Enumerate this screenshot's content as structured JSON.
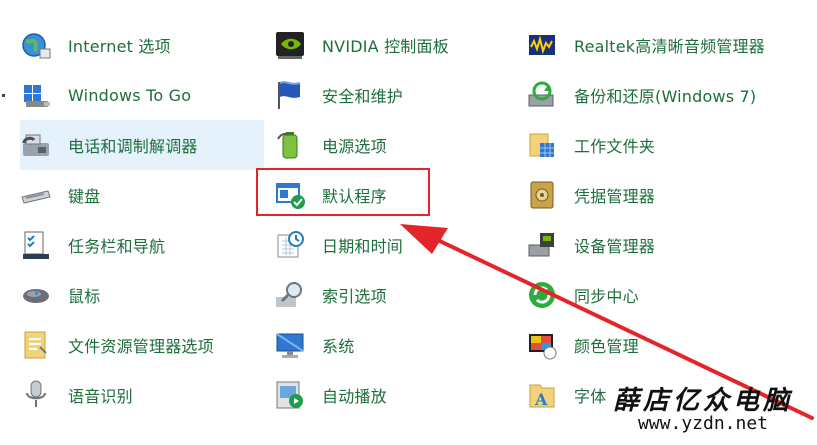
{
  "items": [
    {
      "key": "internet",
      "label": "Internet 选项",
      "icon": "globe-icon",
      "col": 0,
      "row": 0
    },
    {
      "key": "windows-to-go",
      "label": "Windows To Go",
      "icon": "usb-drive-icon",
      "col": 0,
      "row": 1
    },
    {
      "key": "phone-modem",
      "label": "电话和调制解调器",
      "icon": "phone-fax-icon",
      "col": 0,
      "row": 2,
      "hover": true
    },
    {
      "key": "keyboard",
      "label": "键盘",
      "icon": "keyboard-icon",
      "col": 0,
      "row": 3
    },
    {
      "key": "taskbar",
      "label": "任务栏和导航",
      "icon": "taskbar-checklist-icon",
      "col": 0,
      "row": 4
    },
    {
      "key": "mouse",
      "label": "鼠标",
      "icon": "mouse-icon",
      "col": 0,
      "row": 5
    },
    {
      "key": "file-explorer-options",
      "label": "文件资源管理器选项",
      "icon": "folder-options-icon",
      "col": 0,
      "row": 6
    },
    {
      "key": "speech",
      "label": "语音识别",
      "icon": "microphone-icon",
      "col": 0,
      "row": 7
    },
    {
      "key": "nvidia",
      "label": "NVIDIA 控制面板",
      "icon": "nvidia-icon",
      "col": 1,
      "row": 0
    },
    {
      "key": "security-maintenance",
      "label": "安全和维护",
      "icon": "flag-icon",
      "col": 1,
      "row": 1
    },
    {
      "key": "power",
      "label": "电源选项",
      "icon": "battery-icon",
      "col": 1,
      "row": 2
    },
    {
      "key": "default-programs",
      "label": "默认程序",
      "icon": "default-programs-icon",
      "col": 1,
      "row": 3
    },
    {
      "key": "date-time",
      "label": "日期和时间",
      "icon": "calendar-clock-icon",
      "col": 1,
      "row": 4
    },
    {
      "key": "indexing",
      "label": "索引选项",
      "icon": "magnifier-index-icon",
      "col": 1,
      "row": 5
    },
    {
      "key": "system",
      "label": "系统",
      "icon": "monitor-icon",
      "col": 1,
      "row": 6
    },
    {
      "key": "autoplay",
      "label": "自动播放",
      "icon": "autoplay-icon",
      "col": 1,
      "row": 7
    },
    {
      "key": "realtek",
      "label": "Realtek高清晰音频管理器",
      "icon": "audio-meter-icon",
      "col": 2,
      "row": 0
    },
    {
      "key": "backup-restore",
      "label": "备份和还原(Windows 7)",
      "icon": "backup-restore-icon",
      "col": 2,
      "row": 1
    },
    {
      "key": "work-folders",
      "label": "工作文件夹",
      "icon": "work-folders-icon",
      "col": 2,
      "row": 2
    },
    {
      "key": "credential-manager",
      "label": "凭据管理器",
      "icon": "vault-icon",
      "col": 2,
      "row": 3
    },
    {
      "key": "device-manager",
      "label": "设备管理器",
      "icon": "printer-device-icon",
      "col": 2,
      "row": 4
    },
    {
      "key": "sync-center",
      "label": "同步中心",
      "icon": "sync-icon",
      "col": 2,
      "row": 5
    },
    {
      "key": "color-management",
      "label": "颜色管理",
      "icon": "color-monitor-icon",
      "col": 2,
      "row": 6
    },
    {
      "key": "fonts",
      "label": "字体",
      "icon": "font-folder-icon",
      "col": 2,
      "row": 7
    }
  ],
  "watermark": {
    "text_cn": "薛店亿众电脑",
    "url": "www.yzdn.net"
  },
  "colors": {
    "label": "#1e6e3c",
    "hover_bg": "#e5f1fb",
    "annotation_red": "#e3252a"
  }
}
